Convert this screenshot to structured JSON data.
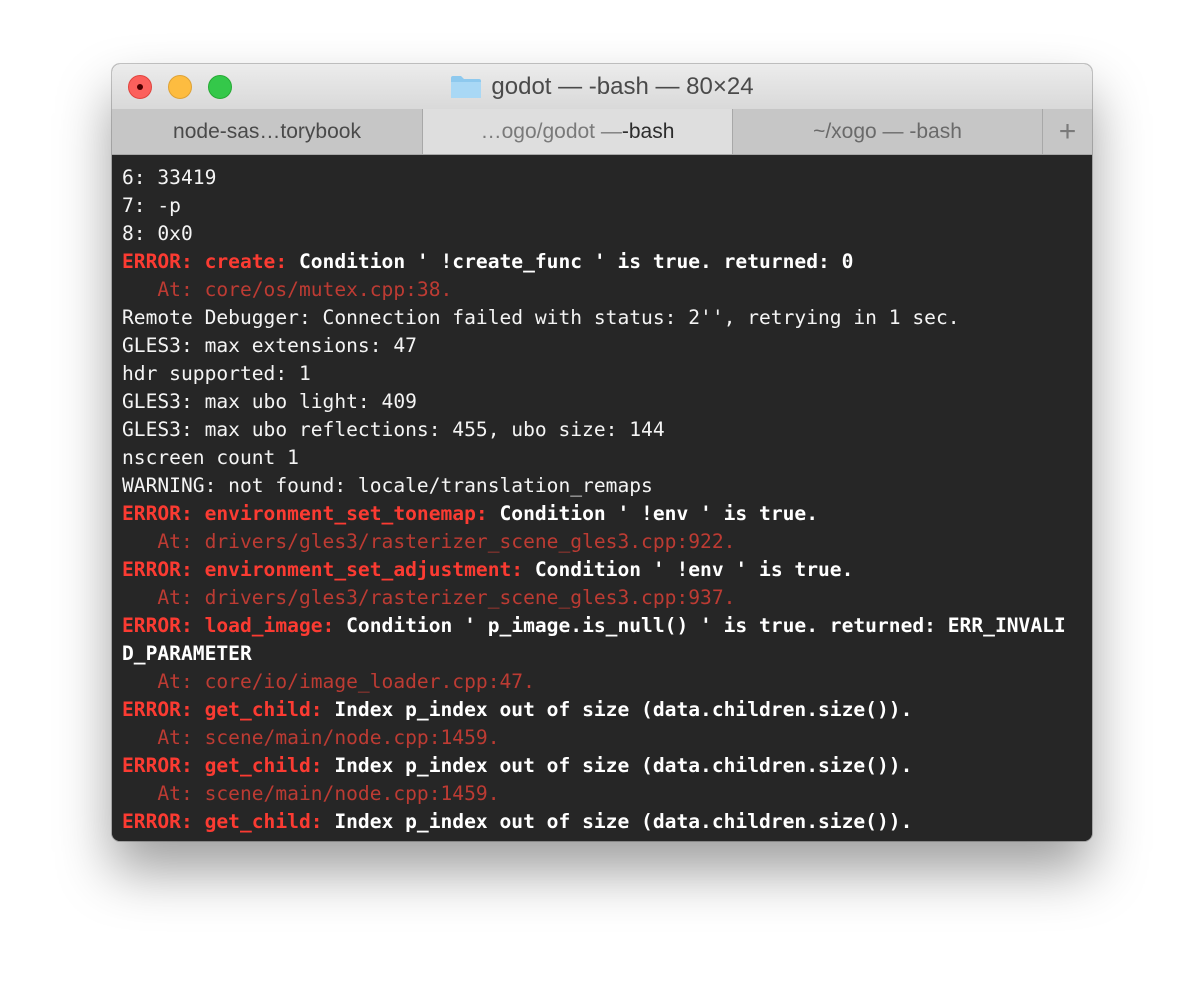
{
  "window": {
    "title": "godot — -bash — 80×24",
    "folder_icon": "folder-icon",
    "traffic_lights": {
      "close": "#fc605c",
      "minimize": "#fdbc40",
      "zoom": "#34c84a"
    }
  },
  "tabs": [
    {
      "pre": "node-sas…torybook",
      "cmd": ""
    },
    {
      "pre": "…ogo/godot — ",
      "cmd": "-bash"
    },
    {
      "pre": "~/xogo — -bash",
      "cmd": ""
    }
  ],
  "new_tab_label": "+",
  "colors": {
    "background": "#262626",
    "text": "#f4f4f4",
    "error": "#fb3b32",
    "location": "#bd3b33"
  },
  "terminal": {
    "lines": [
      {
        "type": "plain",
        "text": "6: 33419"
      },
      {
        "type": "plain",
        "text": "7: -p"
      },
      {
        "type": "plain",
        "text": "8: 0x0"
      },
      {
        "type": "error",
        "label": "ERROR:",
        "func": "create:",
        "msg": "Condition ' !create_func ' is true. returned: 0"
      },
      {
        "type": "at",
        "text": "   At: core/os/mutex.cpp:38."
      },
      {
        "type": "plain",
        "text": "Remote Debugger: Connection failed with status: 2'', retrying in 1 sec."
      },
      {
        "type": "plain",
        "text": "GLES3: max extensions: 47"
      },
      {
        "type": "plain",
        "text": "hdr supported: 1"
      },
      {
        "type": "plain",
        "text": "GLES3: max ubo light: 409"
      },
      {
        "type": "plain",
        "text": "GLES3: max ubo reflections: 455, ubo size: 144"
      },
      {
        "type": "plain",
        "text": "nscreen count 1"
      },
      {
        "type": "plain",
        "text": "WARNING: not found: locale/translation_remaps"
      },
      {
        "type": "error",
        "label": "ERROR:",
        "func": "environment_set_tonemap:",
        "msg": "Condition ' !env ' is true."
      },
      {
        "type": "at",
        "text": "   At: drivers/gles3/rasterizer_scene_gles3.cpp:922."
      },
      {
        "type": "error",
        "label": "ERROR:",
        "func": "environment_set_adjustment:",
        "msg": "Condition ' !env ' is true."
      },
      {
        "type": "at",
        "text": "   At: drivers/gles3/rasterizer_scene_gles3.cpp:937."
      },
      {
        "type": "error",
        "label": "ERROR:",
        "func": "load_image:",
        "msg": "Condition ' p_image.is_null() ' is true. returned: ERR_INVALI"
      },
      {
        "type": "errcont",
        "text": "D_PARAMETER"
      },
      {
        "type": "at",
        "text": "   At: core/io/image_loader.cpp:47."
      },
      {
        "type": "error",
        "label": "ERROR:",
        "func": "get_child:",
        "msg": "Index p_index out of size (data.children.size())."
      },
      {
        "type": "at",
        "text": "   At: scene/main/node.cpp:1459."
      },
      {
        "type": "error",
        "label": "ERROR:",
        "func": "get_child:",
        "msg": "Index p_index out of size (data.children.size())."
      },
      {
        "type": "at",
        "text": "   At: scene/main/node.cpp:1459."
      },
      {
        "type": "error",
        "label": "ERROR:",
        "func": "get_child:",
        "msg": "Index p_index out of size (data.children.size())."
      }
    ]
  }
}
